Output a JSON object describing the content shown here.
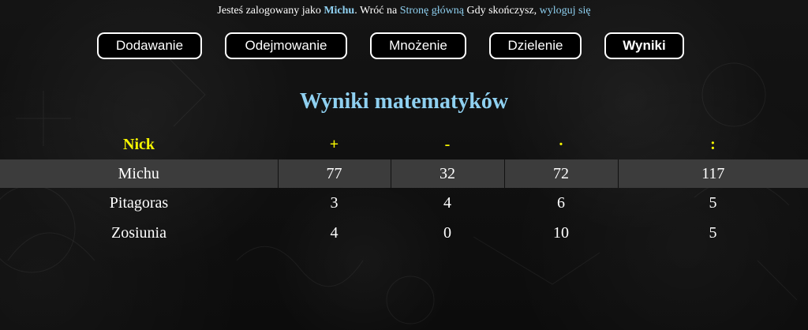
{
  "topbar": {
    "prefix": "Jesteś zalogowany jako",
    "username": "Michu",
    "return_text": ". Wróć na",
    "home_link": "Stronę główną",
    "when_done": "Gdy skończysz,",
    "logout_link": "wyloguj się"
  },
  "nav": {
    "items": [
      {
        "label": "Dodawanie"
      },
      {
        "label": "Odejmowanie"
      },
      {
        "label": "Mnożenie"
      },
      {
        "label": "Dzielenie"
      },
      {
        "label": "Wyniki"
      }
    ]
  },
  "heading": "Wyniki matematyków",
  "table": {
    "headers": [
      "Nick",
      "+",
      "-",
      "·",
      ":"
    ],
    "rows": [
      [
        "Michu",
        "77",
        "32",
        "72",
        "117"
      ],
      [
        "Pitagoras",
        "3",
        "4",
        "6",
        "5"
      ],
      [
        "Zosiunia",
        "4",
        "0",
        "10",
        "5"
      ]
    ]
  },
  "colors": {
    "accent_blue": "#8fd0f0",
    "header_yellow": "#f7f700",
    "highlight_row": "#3c3c3c",
    "background": "#0f0f0f"
  }
}
